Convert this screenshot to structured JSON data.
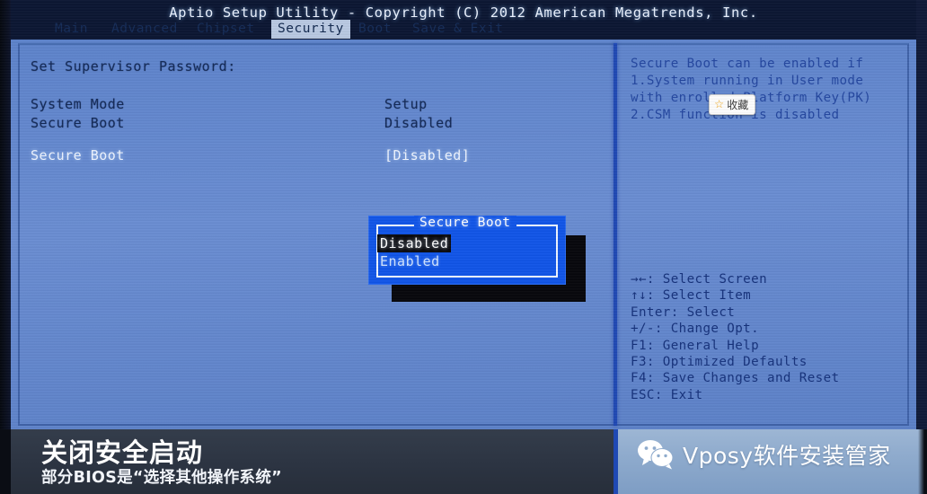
{
  "bios": {
    "title": "Aptio Setup Utility - Copyright (C) 2012 American Megatrends, Inc.",
    "tabs": [
      {
        "label": "Main",
        "active": false
      },
      {
        "label": "Advanced",
        "active": false
      },
      {
        "label": "Chipset",
        "active": false
      },
      {
        "label": "Security",
        "active": true
      },
      {
        "label": "Boot",
        "active": false
      },
      {
        "label": "Save & Exit",
        "active": false
      }
    ],
    "settings": [
      {
        "label": "Set Supervisor Password:",
        "value": "",
        "style": "dark"
      },
      {
        "label": "System Mode",
        "value": "Setup",
        "style": "dark"
      },
      {
        "label": "Secure Boot",
        "value": "Disabled",
        "style": "dark"
      },
      {
        "label": "Secure Boot",
        "value": "[Disabled]",
        "style": "light"
      }
    ],
    "help_lines": [
      "Secure Boot can be enabled if",
      "1.System running in User mode",
      "with enrolled Platform Key(PK)",
      "2.CSM function is disabled"
    ],
    "key_legend": [
      "→←: Select Screen",
      "↑↓: Select Item",
      "Enter: Select",
      "+/-: Change Opt.",
      "F1: General Help",
      "F3: Optimized Defaults",
      "F4: Save Changes and Reset",
      "ESC: Exit"
    ],
    "popup": {
      "title": "Secure Boot",
      "options": [
        {
          "label": "Disabled",
          "selected": true
        },
        {
          "label": "Enabled",
          "selected": false
        }
      ]
    },
    "favorite_badge": {
      "icon": "star-icon",
      "label": "收藏"
    }
  },
  "caption": {
    "headline": "关闭安全启动",
    "subline": "部分BIOS是“选择其他操作系统”"
  },
  "brand": {
    "logo": "wechat-icon",
    "name": "Vposy软件安装管家"
  },
  "colors": {
    "bios_field": "#5d83cb",
    "bios_header": "#0b1632",
    "popup_blue": "#1155e8",
    "divider_blue": "#1f49b4",
    "caption_bg": "#2c3442",
    "brand_bg": "#8fabcd",
    "star_gold": "#f0a81e"
  }
}
